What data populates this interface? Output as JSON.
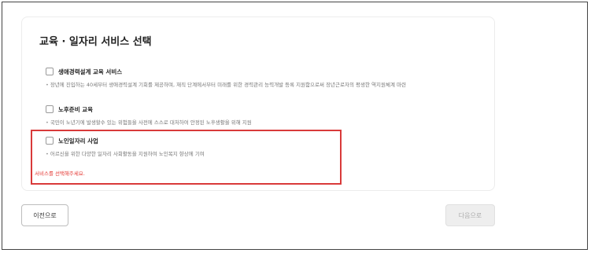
{
  "section": {
    "title": "교육 · 일자리 서비스 선택"
  },
  "options": [
    {
      "label": "생애경력설계 교육 서비스",
      "bullet": "•",
      "desc": "장년에 진입하는 40세부터 생애경력설계 기회를 제공하며, 재직 단계에서부터 미래를 위한 경력관리 능력개발 등록 지원함으로써 장년근로자의 평생한 역지원체계 마련"
    },
    {
      "label": "노후준비 교육",
      "bullet": "•",
      "desc": "국민이 노년기에 발생할수 있는 위험들을 사전에 스스로 대처하여 안정된 노후생활을 위해 지원"
    },
    {
      "label": "노인일자리 사업",
      "bullet": "•",
      "desc": "어르신을 위한 다양한 일자리 사회활동을 지원하여 노인복지 향상에 기여"
    }
  ],
  "error": "서비스를 선택해주세요.",
  "buttons": {
    "prev": "이전으로",
    "next": "다음으로"
  }
}
